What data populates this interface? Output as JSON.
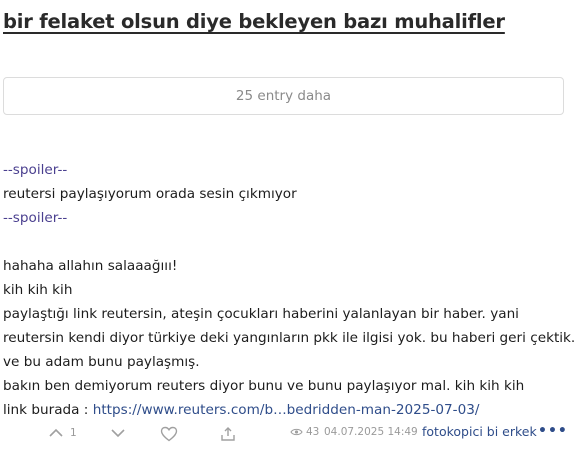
{
  "topic": {
    "title": "bir felaket olsun diye bekleyen bazı muhalifler"
  },
  "more_entries": {
    "label": "25 entry daha"
  },
  "entry": {
    "spoiler_open": "--spoiler--",
    "spoiler_text": "reutersi paylaşıyorum orada sesin çıkmıyor",
    "spoiler_close": "--spoiler--",
    "lines": [
      "hahaha allahın salaaağııı!",
      "kih kih kih",
      "paylaştığı link reutersin, ateşin çocukları haberini yalanlayan bir haber. yani",
      "reutersin kendi diyor türkiye deki yangınların pkk ile ilgisi yok. bu haberi geri çektik.",
      "ve bu adam bunu paylaşmış.",
      "bakın ben demiyorum reuters diyor bunu ve bunu paylaşıyor mal. kih kih kih"
    ],
    "link_prefix": "link burada : ",
    "link_text": "https://www.reuters.com/b…bedridden-man-2025-07-03/"
  },
  "footer": {
    "upvote_count": "1",
    "views": "43",
    "date": "04.07.2025 14:49",
    "author": "fotokopici bi erkek",
    "more_label": "•••",
    "icons": [
      "upvote-icon",
      "downvote-icon",
      "favorite-icon",
      "share-icon",
      "eye-icon"
    ],
    "accent_color": "#2f4d8a"
  }
}
